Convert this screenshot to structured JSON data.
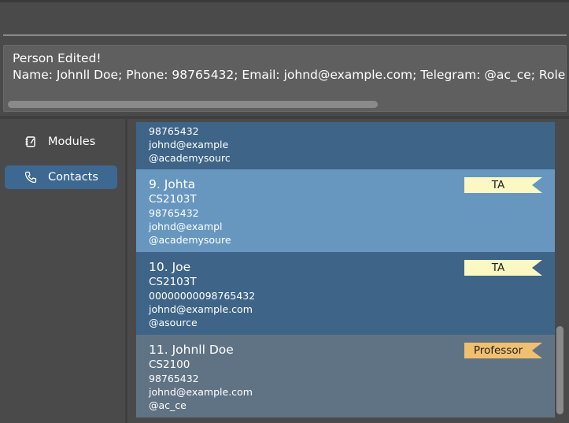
{
  "command": {
    "value": "",
    "placeholder": ""
  },
  "result": {
    "line1": "Person Edited!",
    "line2": "Name: Johnll Doe; Phone: 98765432; Email: johnd@example.com; Telegram: @ac_ce; Role: Professor"
  },
  "sidebar": {
    "items": [
      {
        "label": "Modules",
        "icon": "modules-icon",
        "active": false
      },
      {
        "label": "Contacts",
        "icon": "phone-icon",
        "active": true
      }
    ]
  },
  "contacts": [
    {
      "partial": true,
      "phone": "98765432",
      "email": "johnd@example",
      "telegram": "@academysourc"
    },
    {
      "name": "9. Johta",
      "module": "CS2103T",
      "phone": "98765432",
      "email": "johnd@exampl",
      "telegram": "@academysoure",
      "role": "TA",
      "role_color": "#fbf8c4"
    },
    {
      "name": "10. Joe",
      "module": "CS2103T",
      "phone": "00000000098765432",
      "email": "johnd@example.com",
      "telegram": "@asource",
      "role": "TA",
      "role_color": "#fbf8c4"
    },
    {
      "name": "11. Johnll Doe",
      "module": "CS2100",
      "phone": "98765432",
      "email": "johnd@example.com",
      "telegram": "@ac_ce",
      "role": "Professor",
      "role_color": "#f0c070"
    }
  ],
  "colors": {
    "accent": "#3c6891",
    "card_dark": "#3e6487",
    "card_light": "#6797bf",
    "card_selected": "#607385"
  }
}
